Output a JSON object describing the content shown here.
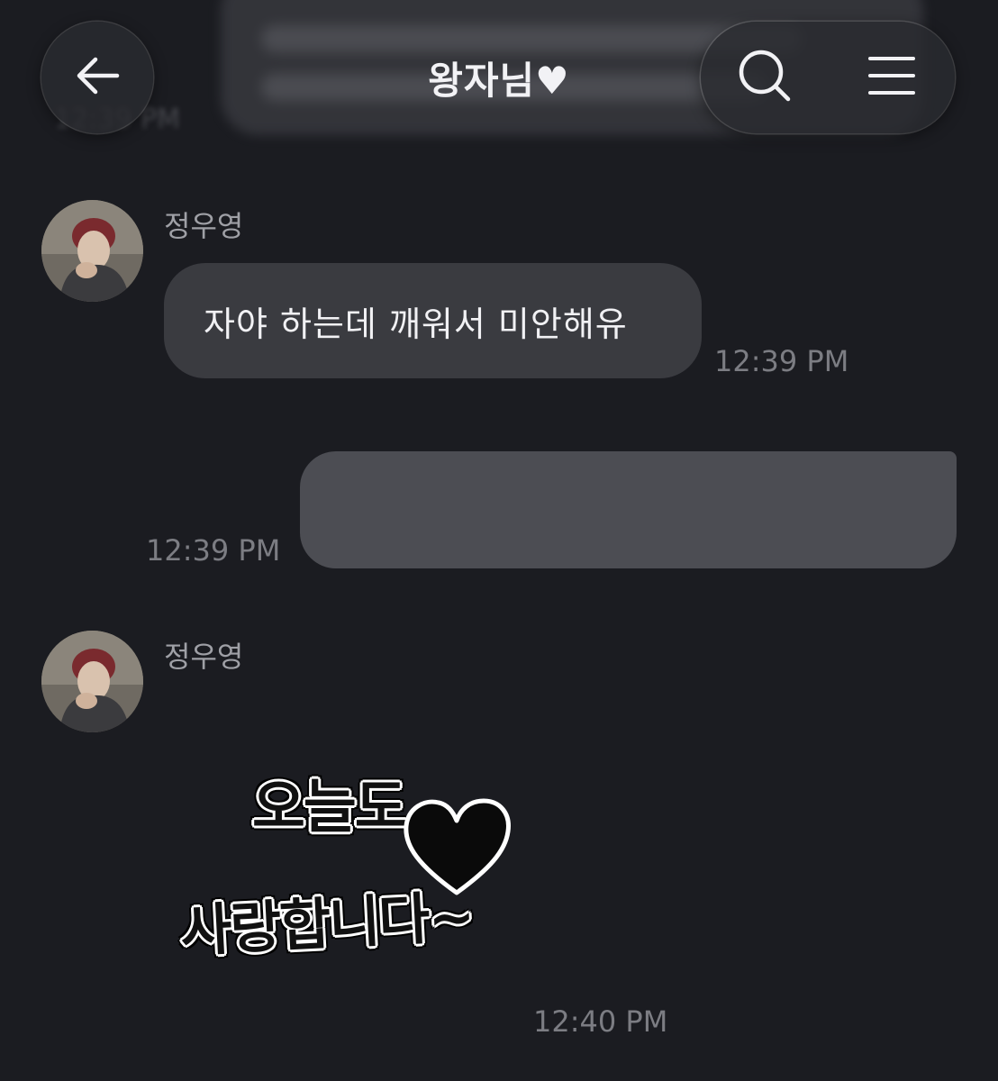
{
  "header": {
    "title": "왕자님♥",
    "back_icon": "arrow-left-icon",
    "search_icon": "search-icon",
    "menu_icon": "menu-icon"
  },
  "messages": [
    {
      "sender": "정우영",
      "text": "자야 하는데 깨워서 미안해유",
      "time": "12:39 PM",
      "direction": "incoming"
    },
    {
      "text": "",
      "time": "12:39 PM",
      "direction": "outgoing",
      "redacted": true
    },
    {
      "sender": "정우영",
      "sticker_line1": "오늘도",
      "sticker_line2": "사랑합니다~",
      "time": "12:40 PM",
      "direction": "incoming"
    }
  ],
  "colors": {
    "background": "#1b1c21",
    "incoming_bubble": "#3a3b40",
    "outgoing_bubble": "#4c4d53",
    "timestamp": "#7c7d83"
  }
}
